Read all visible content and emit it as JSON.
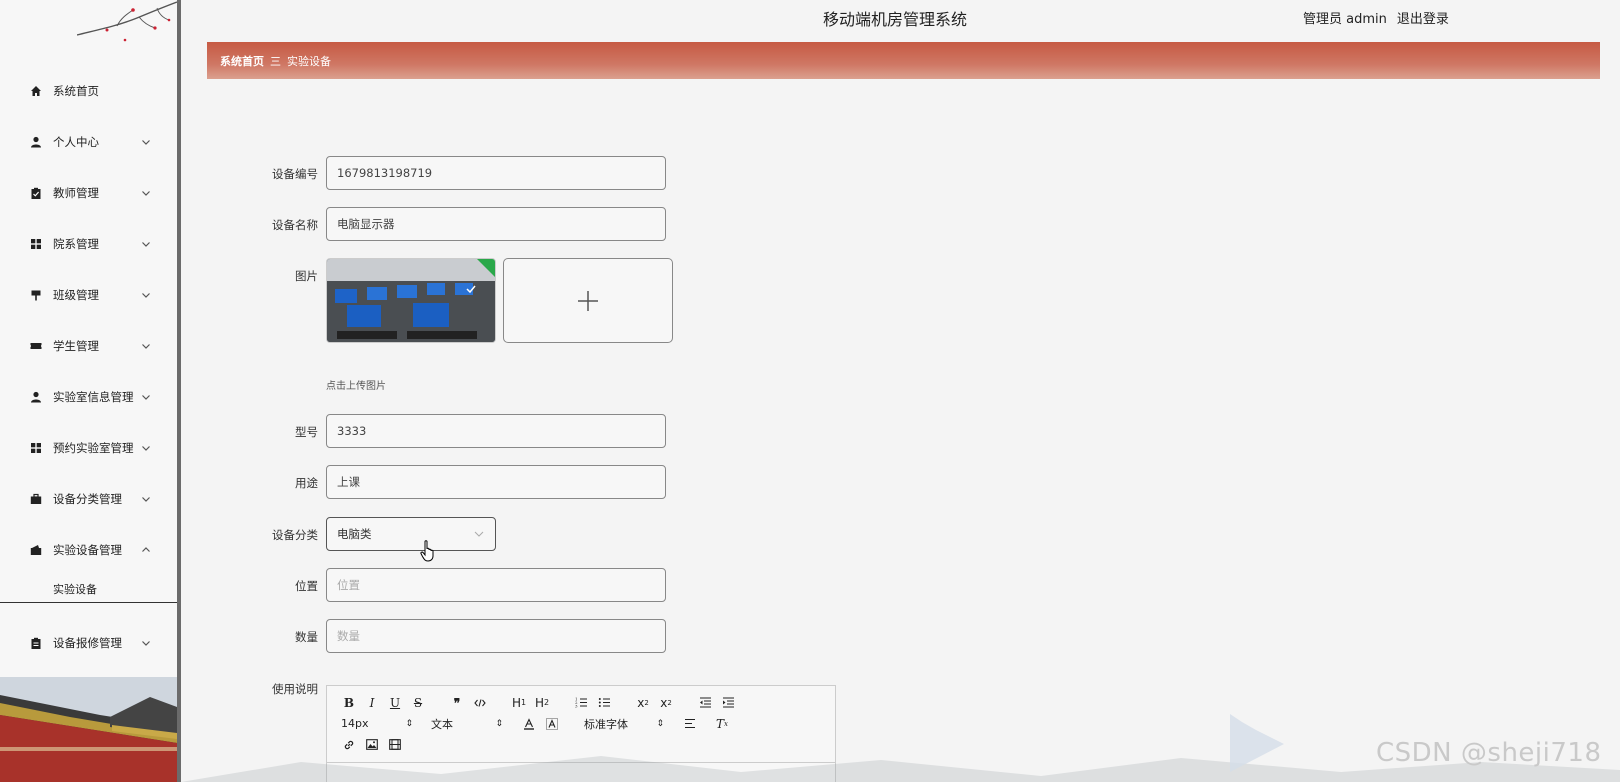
{
  "header": {
    "app_title": "移动端机房管理系统",
    "user_label": "管理员 admin",
    "logout_label": "退出登录"
  },
  "breadcrumb": {
    "home": "系统首页",
    "separator": "三",
    "current": "实验设备"
  },
  "sidebar": {
    "items": [
      {
        "label": "系统首页",
        "icon": "home-icon"
      },
      {
        "label": "个人中心",
        "icon": "person-icon"
      },
      {
        "label": "教师管理",
        "icon": "clipboard-icon"
      },
      {
        "label": "院系管理",
        "icon": "grid-icon"
      },
      {
        "label": "班级管理",
        "icon": "sign-icon"
      },
      {
        "label": "学生管理",
        "icon": "ticket-icon"
      },
      {
        "label": "实验室信息管理",
        "icon": "person-icon"
      },
      {
        "label": "预约实验室管理",
        "icon": "grid-icon"
      },
      {
        "label": "设备分类管理",
        "icon": "briefcase-icon"
      },
      {
        "label": "实验设备管理",
        "icon": "wallet-icon"
      },
      {
        "label": "设备报修管理",
        "icon": "clipboard-icon"
      }
    ],
    "submenu": [
      "实验设备"
    ]
  },
  "form": {
    "device_no_label": "设备编号",
    "device_no_value": "1679813198719",
    "device_name_label": "设备名称",
    "device_name_value": "电脑显示器",
    "image_label": "图片",
    "upload_tip": "点击上传图片",
    "model_label": "型号",
    "model_value": "3333",
    "usage_label": "用途",
    "usage_value": "上课",
    "category_label": "设备分类",
    "category_value": "电脑类",
    "location_label": "位置",
    "location_placeholder": "位置",
    "quantity_label": "数量",
    "quantity_placeholder": "数量",
    "instructions_label": "使用说明"
  },
  "editor": {
    "font_size": "14px",
    "text_style": "文本",
    "font_family": "标准字体"
  },
  "watermark": "CSDN @sheji718"
}
